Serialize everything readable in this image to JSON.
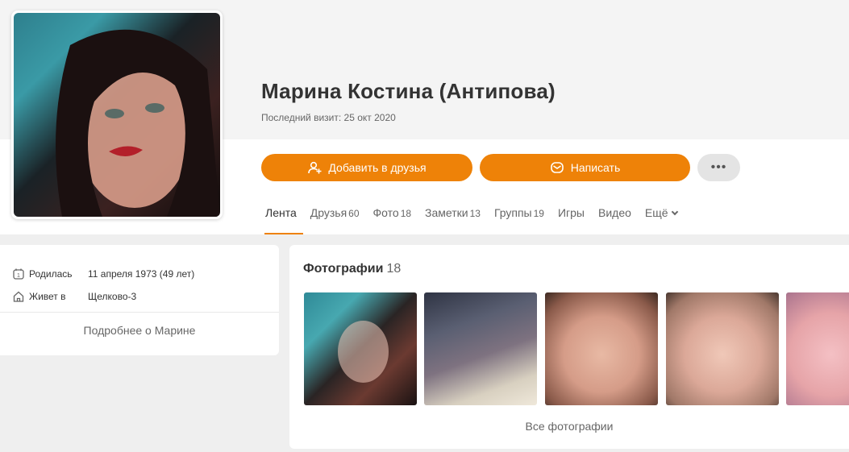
{
  "profile": {
    "name": "Марина Костина (Антипова)",
    "last_visit": "Последний визит: 25 окт 2020"
  },
  "actions": {
    "add_friend": "Добавить в друзья",
    "write": "Написать",
    "more": "•••"
  },
  "tabs": [
    {
      "label": "Лента",
      "count": ""
    },
    {
      "label": "Друзья",
      "count": "60"
    },
    {
      "label": "Фото",
      "count": "18"
    },
    {
      "label": "Заметки",
      "count": "13"
    },
    {
      "label": "Группы",
      "count": "19"
    },
    {
      "label": "Игры",
      "count": ""
    },
    {
      "label": "Видео",
      "count": ""
    },
    {
      "label": "Ещё",
      "count": ""
    }
  ],
  "info": {
    "born_label": "Родилась",
    "born_value": "11 апреля 1973 (49 лет)",
    "lives_label": "Живет в",
    "lives_value": "Щелково-3",
    "more": "Подробнее о Марине"
  },
  "photos": {
    "title": "Фотографии",
    "count": "18",
    "all": "Все фотографии"
  },
  "colors": {
    "accent": "#ee8208"
  },
  "icons": {
    "add_friend": "add-friend-icon",
    "write": "envelope-icon",
    "born": "calendar-icon",
    "lives": "home-icon",
    "more_tabs": "chevron-down-icon"
  }
}
